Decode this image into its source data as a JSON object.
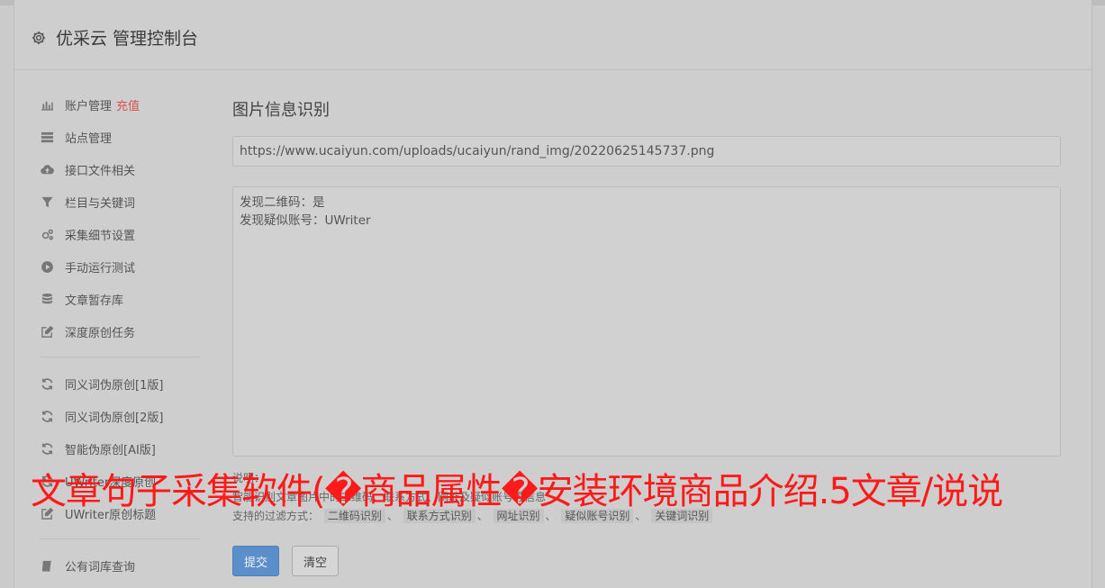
{
  "header": {
    "title": "优采云 管理控制台",
    "icon": "gear-icon"
  },
  "sidebar": {
    "groups": [
      [
        {
          "label": "账户管理",
          "extra": "充值",
          "icon": "bar-chart-icon"
        },
        {
          "label": "站点管理",
          "icon": "server-icon"
        },
        {
          "label": "接口文件相关",
          "icon": "cloud-upload-icon"
        },
        {
          "label": "栏目与关键词",
          "icon": "filter-icon"
        },
        {
          "label": "采集细节设置",
          "icon": "gears-icon"
        },
        {
          "label": "手动运行测试",
          "icon": "play-circle-icon"
        },
        {
          "label": "文章暂存库",
          "icon": "database-icon"
        },
        {
          "label": "深度原创任务",
          "icon": "edit-icon"
        }
      ],
      [
        {
          "label": "同义词伪原创[1版]",
          "icon": "refresh-icon"
        },
        {
          "label": "同义词伪原创[2版]",
          "icon": "refresh-icon"
        },
        {
          "label": "智能伪原创[AI版]",
          "icon": "refresh-icon"
        },
        {
          "label": "UWriter深度原创",
          "icon": "refresh-icon"
        },
        {
          "label": "UWriter原创标题",
          "icon": "edit-icon"
        }
      ],
      [
        {
          "label": "公有词库查询",
          "icon": "book-icon"
        }
      ]
    ]
  },
  "main": {
    "title": "图片信息识别",
    "url_value": "https://www.ucaiyun.com/uploads/ucaiyun/rand_img/20220625145737.png",
    "result_lines": [
      "发现二维码：是",
      "发现疑似账号：UWriter"
    ],
    "notes_label": "说明：",
    "notes_line1": "智能识别文章图片中的二维码、联系方式、网址及疑似账号等信息",
    "filter_label": "支持的过滤方式：",
    "filter_tags": [
      "二维码识别",
      "联系方式识别",
      "网址识别",
      "疑似账号识别",
      "关键词识别"
    ],
    "submit_label": "提交",
    "clear_label": "清空"
  },
  "overlay_text": "文章句子采集软件(�商品属性�安装环境商品介绍.5文章/说说",
  "colors": {
    "overlay": "#ff1a1a",
    "accent": "#5b8fc9",
    "extra": "#d9534f"
  }
}
